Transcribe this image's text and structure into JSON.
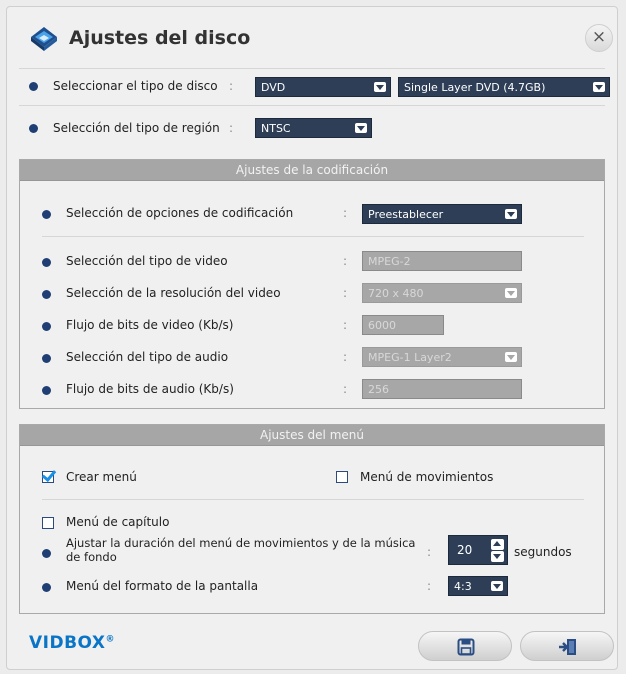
{
  "window": {
    "title": "Ajustes del disco",
    "close_glyph": "×"
  },
  "disc": {
    "type_label": "Seleccionar el tipo de disco",
    "type_value": "DVD",
    "layer_value": "Single Layer DVD (4.7GB)",
    "region_label": "Selección del tipo de región",
    "region_value": "NTSC"
  },
  "encoding": {
    "header": "Ajustes de la codificación",
    "options_label": "Selección de opciones de codificación",
    "options_value": "Preestablecer",
    "video_type_label": "Selección del tipo de video",
    "video_type_value": "MPEG-2",
    "resolution_label": "Selección de la resolución del video",
    "resolution_value": "720 x 480",
    "video_bitrate_label": "Flujo de bits de video (Kb/s)",
    "video_bitrate_value": "6000",
    "audio_type_label": "Selección del tipo de audio",
    "audio_type_value": "MPEG-1 Layer2",
    "audio_bitrate_label": "Flujo de bits de audio (Kb/s)",
    "audio_bitrate_value": "256"
  },
  "menu": {
    "header": "Ajustes del menú",
    "create_menu_label": "Crear menú",
    "create_menu_checked": true,
    "motion_menu_label": "Menú de movimientos",
    "motion_menu_checked": false,
    "chapter_menu_label": "Menú de capítulo",
    "chapter_menu_checked": false,
    "duration_label_line1": "Ajustar la duración del menú de movimientos y de la música",
    "duration_label_line2": "de fondo",
    "duration_value": "20",
    "duration_unit": "segundos",
    "screen_format_label": "Menú del formato de la pantalla",
    "screen_format_value": "4:3"
  },
  "colon": ":",
  "footer": {
    "logo_text": "VIDBOX",
    "logo_mark": "®",
    "save_icon": "save-icon",
    "exit_icon": "exit-icon"
  },
  "colors": {
    "accent": "#1f3f74",
    "select_bg": "#2d3e56",
    "disabled_bg": "#a7a7a7",
    "brand": "#0a75c7"
  }
}
